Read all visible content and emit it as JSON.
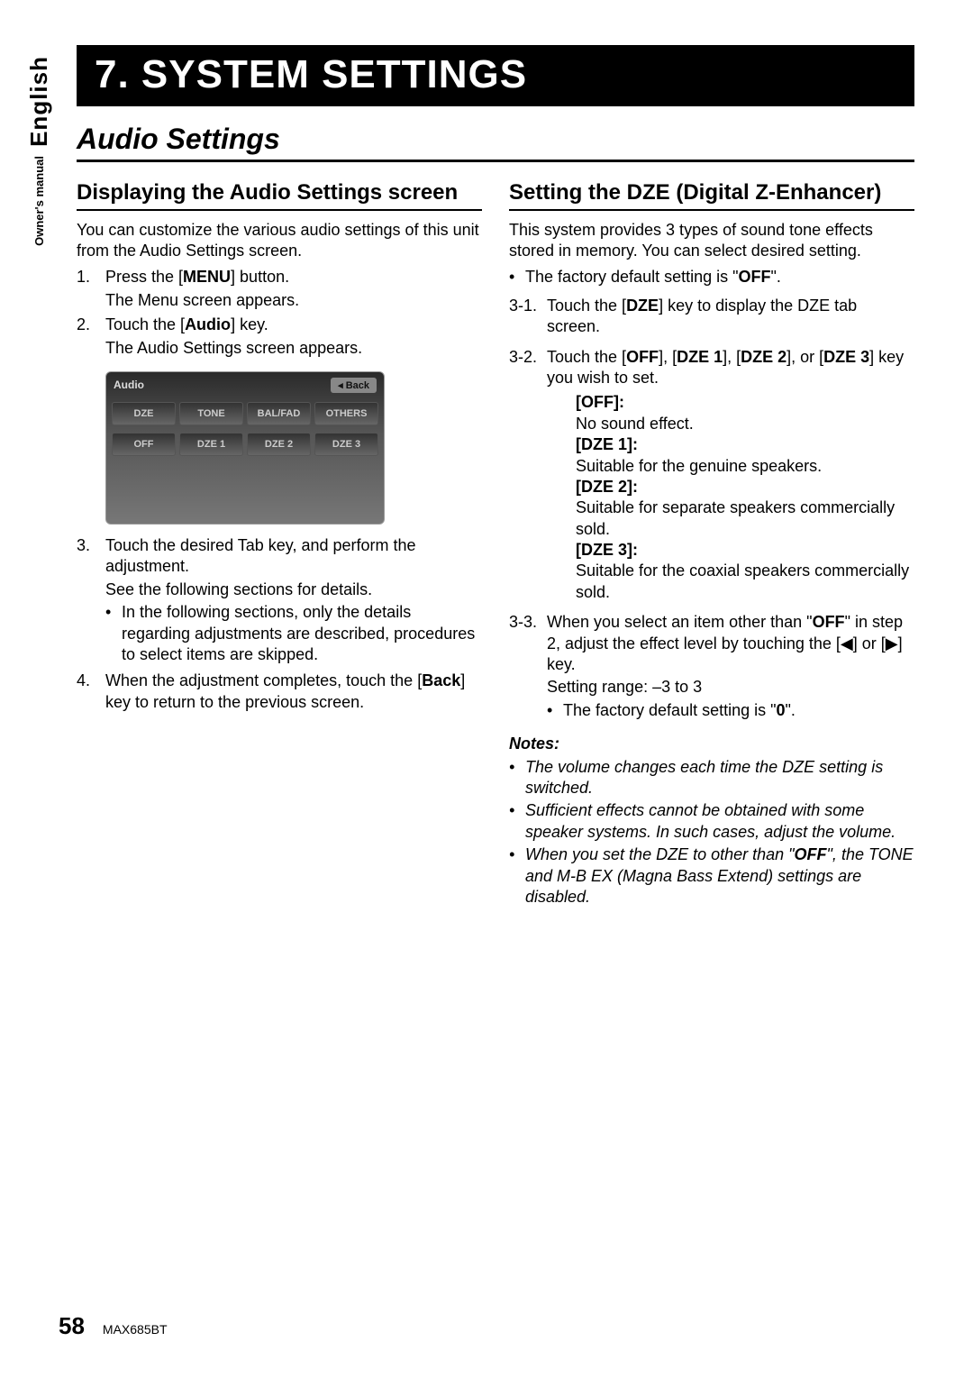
{
  "side": {
    "lang": "English",
    "owners": "Owner's manual"
  },
  "chapter": "7.  SYSTEM SETTINGS",
  "section": "Audio Settings",
  "left": {
    "heading": "Displaying the Audio Settings screen",
    "intro": "You can customize the various audio settings of this unit from the Audio Settings screen.",
    "s1n": "1.",
    "s1a": "Press the [",
    "s1b": "MENU",
    "s1c": "] button.",
    "s1d": "The Menu screen appears.",
    "s2n": "2.",
    "s2a": "Touch the [",
    "s2b": "Audio",
    "s2c": "] key.",
    "s2d": "The Audio Settings screen appears.",
    "fig": {
      "title": "Audio",
      "back": "◂ Back",
      "tabs": [
        "DZE",
        "TONE",
        "BAL/FAD",
        "OTHERS"
      ],
      "opts": [
        "OFF",
        "DZE 1",
        "DZE 2",
        "DZE 3"
      ]
    },
    "s3n": "3.",
    "s3a": "Touch the desired Tab key, and perform the adjustment.",
    "s3b": "See the following sections for details.",
    "s3bullet": "In the following sections, only the details regarding adjustments are described, procedures to select items are skipped.",
    "s4n": "4.",
    "s4a": "When the adjustment completes, touch the [",
    "s4b": "Back",
    "s4c": "] key to return to the previous screen."
  },
  "right": {
    "heading": "Setting the DZE (Digital Z-Enhancer)",
    "intro": "This system provides 3 types of sound tone effects stored in memory. You can select desired setting.",
    "b1a": "The factory default setting is \"",
    "b1b": "OFF",
    "b1c": "\".",
    "s31n": "3-1.",
    "s31a": "Touch the [",
    "s31b": "DZE",
    "s31c": "] key to display the DZE tab screen.",
    "s32n": "3-2.",
    "s32a": "Touch the [",
    "s32b": "OFF",
    "s32c": "], [",
    "s32d": "DZE 1",
    "s32e": "], [",
    "s32f": "DZE 2",
    "s32g": "], or [",
    "s32h": "DZE 3",
    "s32i": "] key you wish to set.",
    "off_l": "[OFF]:",
    "off_t": "No sound effect.",
    "d1_l": "[DZE 1]:",
    "d1_t": "Suitable for the genuine speakers.",
    "d2_l": "[DZE 2]:",
    "d2_t": "Suitable for separate speakers commercially sold.",
    "d3_l": "[DZE 3]:",
    "d3_t": "Suitable for the coaxial speakers commercially sold.",
    "s33n": "3-3.",
    "s33a": "When you select an item other than \"",
    "s33b": "OFF",
    "s33c": "\" in step 2, adjust the effect level by touching the [◀] or [▶] key.",
    "s33d": "Setting range: –3 to 3",
    "s33e_a": "The factory default setting is \"",
    "s33e_b": "0",
    "s33e_c": "\".",
    "notes_h": "Notes:",
    "n1": "The volume changes each time the DZE setting is switched.",
    "n2": "Sufficient effects cannot be obtained with some speaker systems. In such cases, adjust the volume.",
    "n3a": "When you set the DZE to other than \"",
    "n3b": "OFF",
    "n3c": "\", the TONE and M-B EX (Magna Bass Extend) settings are disabled."
  },
  "footer": {
    "page": "58",
    "model": "MAX685BT"
  }
}
